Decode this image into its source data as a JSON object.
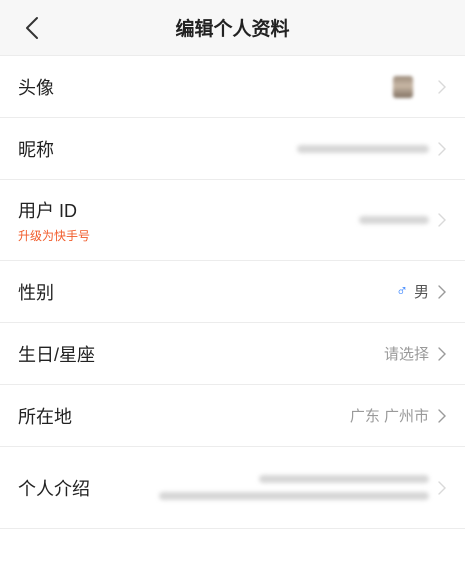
{
  "header": {
    "title": "编辑个人资料"
  },
  "rows": {
    "avatar": {
      "label": "头像"
    },
    "nickname": {
      "label": "昵称"
    },
    "userid": {
      "label": "用户 ID",
      "sublabel": "升级为快手号"
    },
    "gender": {
      "label": "性别",
      "value": "男",
      "symbol": "♂"
    },
    "birthday": {
      "label": "生日/星座",
      "value": "请选择"
    },
    "location": {
      "label": "所在地",
      "value": "广东 广州市"
    },
    "intro": {
      "label": "个人介绍"
    }
  },
  "colors": {
    "accent": "#f15c2b",
    "male": "#2a7bff"
  }
}
